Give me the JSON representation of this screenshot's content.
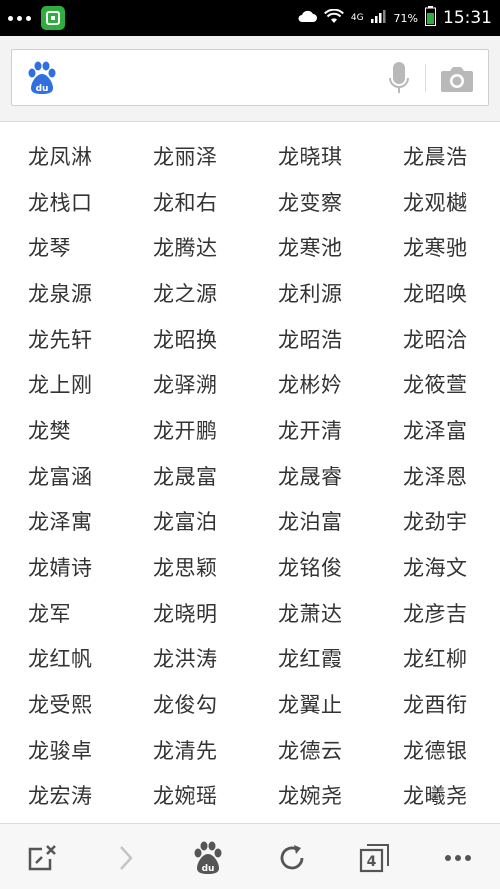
{
  "status_bar": {
    "network": "4G",
    "battery_percent": "71%",
    "time": "15:31"
  },
  "search": {
    "value": ""
  },
  "names": [
    [
      "龙凤淋",
      "龙丽泽",
      "龙晓琪",
      "龙晨浩"
    ],
    [
      "龙栈口",
      "龙和右",
      "龙变察",
      "龙观樾"
    ],
    [
      "龙琴",
      "龙腾达",
      "龙寒池",
      "龙寒驰"
    ],
    [
      "龙泉源",
      "龙之源",
      "龙利源",
      "龙昭唤"
    ],
    [
      "龙先轩",
      "龙昭换",
      "龙昭浩",
      "龙昭洽"
    ],
    [
      "龙上刚",
      "龙驿溯",
      "龙彬妗",
      "龙筱萱"
    ],
    [
      "龙樊",
      "龙开鹏",
      "龙开清",
      "龙泽富"
    ],
    [
      "龙富涵",
      "龙晟富",
      "龙晟睿",
      "龙泽恩"
    ],
    [
      "龙泽寓",
      "龙富泊",
      "龙泊富",
      "龙劲宇"
    ],
    [
      "龙婧诗",
      "龙思颖",
      "龙铭俊",
      "龙海文"
    ],
    [
      "龙军",
      "龙晓明",
      "龙萧达",
      "龙彦吉"
    ],
    [
      "龙红帆",
      "龙洪涛",
      "龙红霞",
      "龙红柳"
    ],
    [
      "龙受熙",
      "龙俊勾",
      "龙翼止",
      "龙酉衔"
    ],
    [
      "龙骏卓",
      "龙清先",
      "龙德云",
      "龙德银"
    ],
    [
      "龙宏涛",
      "龙婉瑶",
      "龙婉尧",
      "龙曦尧"
    ]
  ],
  "toolbar": {
    "tabs_count": "4"
  },
  "colors": {
    "status_bar_bg": "#000000",
    "app_badge": "#2fae3f",
    "baidu_blue": "#2f6fe0",
    "text": "#333333"
  }
}
